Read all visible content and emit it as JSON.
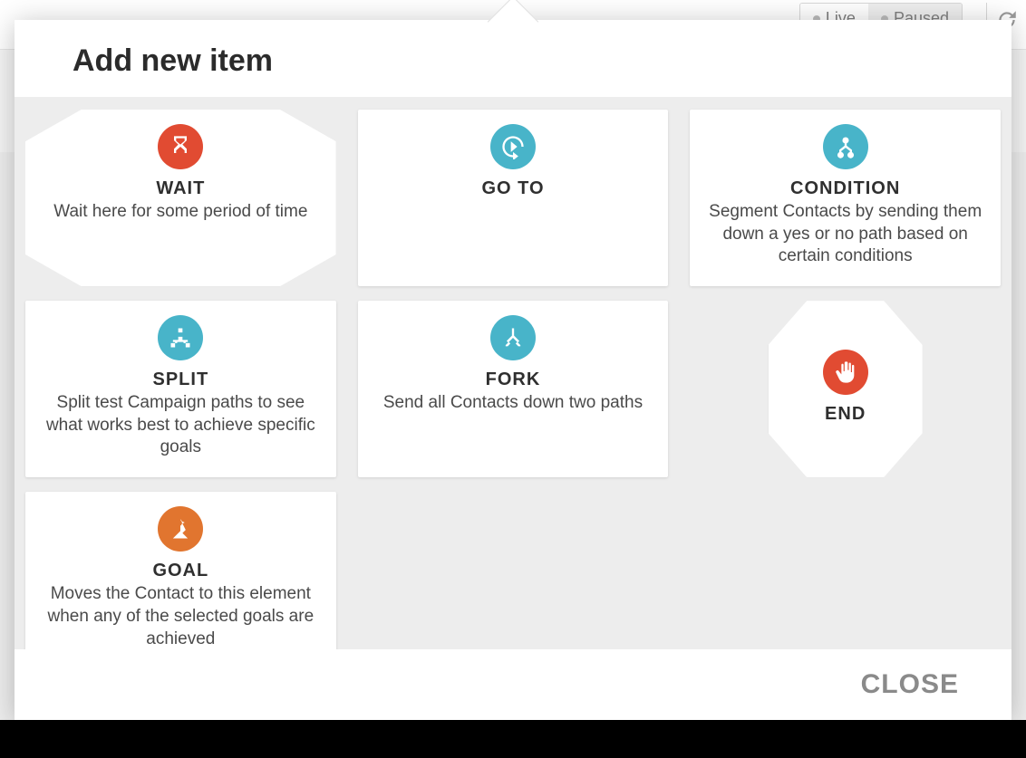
{
  "header": {
    "live_label": "Live",
    "paused_label": "Paused",
    "active_status": "paused"
  },
  "modal": {
    "title": "Add new item",
    "close_label": "CLOSE",
    "items": {
      "wait": {
        "title": "WAIT",
        "desc": "Wait here for some period of time",
        "icon": "hourglass-icon",
        "color": "red",
        "shape": "octagon"
      },
      "goto": {
        "title": "GO TO",
        "desc": "",
        "icon": "goto-arrow-icon",
        "color": "teal",
        "shape": "rect"
      },
      "condition": {
        "title": "CONDITION",
        "desc": "Segment Contacts by sending them down a yes or no path based on certain conditions",
        "icon": "branch-icon",
        "color": "teal",
        "shape": "rect"
      },
      "split": {
        "title": "SPLIT",
        "desc": "Split test Campaign paths to see what works best to achieve specific goals",
        "icon": "sitemap-icon",
        "color": "teal",
        "shape": "rect"
      },
      "fork": {
        "title": "FORK",
        "desc": "Send all Contacts down two paths",
        "icon": "fork-icon",
        "color": "teal",
        "shape": "rect"
      },
      "end": {
        "title": "END",
        "desc": "",
        "icon": "stop-hand-icon",
        "color": "red",
        "shape": "octagon-small"
      },
      "goal": {
        "title": "GOAL",
        "desc": "Moves the Contact to this element when any of the selected goals are achieved",
        "icon": "flag-mountain-icon",
        "color": "orange",
        "shape": "rect"
      }
    }
  }
}
